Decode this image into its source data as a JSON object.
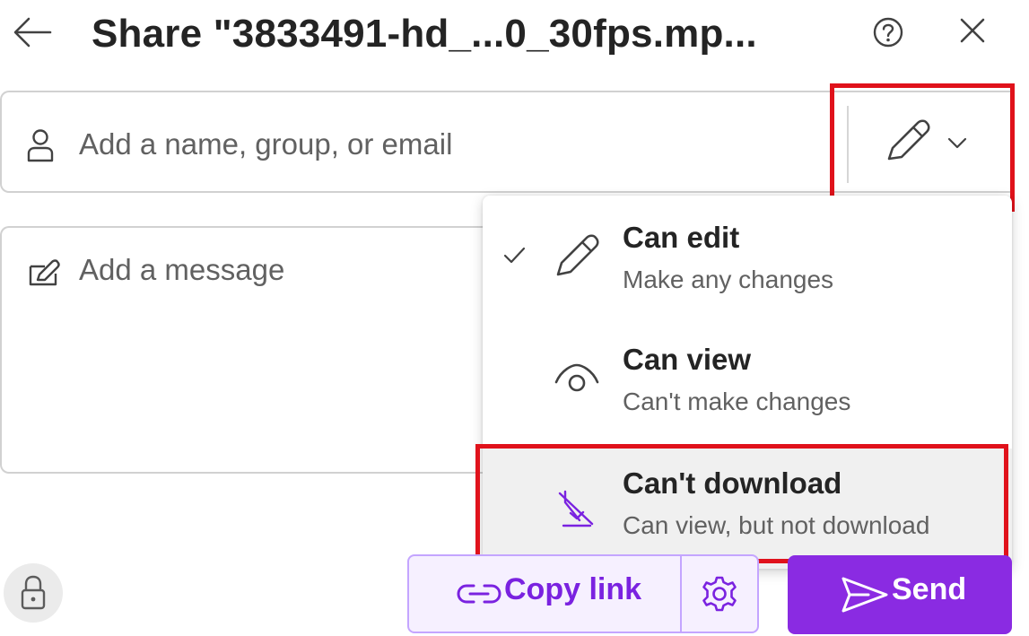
{
  "header": {
    "title": "Share \"3833491-hd_...0_30fps.mp...",
    "back_icon": "arrow-left-icon",
    "help_icon": "question-circle-icon",
    "close_icon": "close-icon"
  },
  "recipient": {
    "placeholder": "Add a name, group, or email",
    "value": "",
    "person_icon": "person-icon",
    "permission_icon": "pencil-icon",
    "chevron_icon": "chevron-down-icon"
  },
  "message": {
    "placeholder": "Add a message",
    "value": "",
    "icon": "compose-icon"
  },
  "permission_menu": {
    "selected": "Can edit",
    "items": [
      {
        "title": "Can edit",
        "subtitle": "Make any changes",
        "icon": "pencil-icon",
        "checked": true
      },
      {
        "title": "Can view",
        "subtitle": "Can't make changes",
        "icon": "eye-icon",
        "checked": false
      },
      {
        "title": "Can't download",
        "subtitle": "Can view, but not download",
        "icon": "no-download-icon",
        "checked": false,
        "highlighted": true
      }
    ]
  },
  "footer": {
    "lock_icon": "lock-icon",
    "copy_link_label": "Copy link",
    "copy_link_icon": "link-icon",
    "settings_icon": "gear-icon",
    "send_label": "Send",
    "send_icon": "send-icon"
  },
  "colors": {
    "accent": "#8a2be2",
    "accent_text": "#7a22e0",
    "accent_light_bg": "#f6f0ff",
    "accent_border": "#c4a5ff",
    "annotation_red": "#e0121b",
    "text_primary": "#242424",
    "text_secondary": "#616161"
  }
}
